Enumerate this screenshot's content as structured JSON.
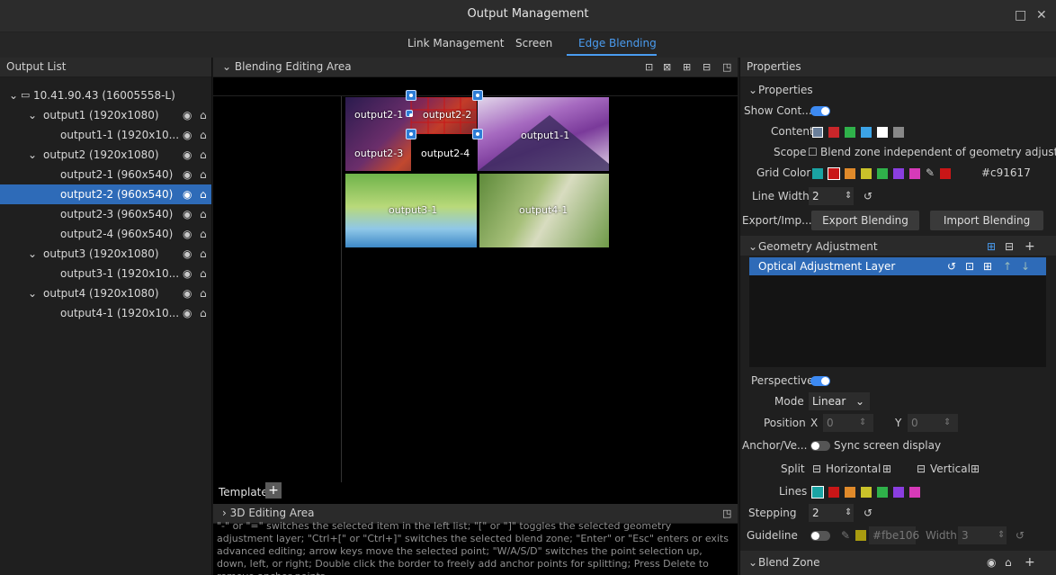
{
  "window": {
    "title": "Output Management",
    "restore_glyph": "□",
    "close_glyph": "✕"
  },
  "tabs": [
    {
      "label": "Link Management"
    },
    {
      "label": "Screen"
    },
    {
      "label": "Edge Blending"
    }
  ],
  "output_list": {
    "header": "Output List",
    "items": [
      {
        "label": "10.41.90.43 (16005558-L)"
      },
      {
        "label": "output1 (1920x1080)"
      },
      {
        "label": "output1-1 (1920x10..."
      },
      {
        "label": "output2 (1920x1080)"
      },
      {
        "label": "output2-1 (960x540)"
      },
      {
        "label": "output2-2 (960x540)"
      },
      {
        "label": "output2-3 (960x540)"
      },
      {
        "label": "output2-4 (960x540)"
      },
      {
        "label": "output3 (1920x1080)"
      },
      {
        "label": "output3-1 (1920x10..."
      },
      {
        "label": "output4 (1920x1080)"
      },
      {
        "label": "output4-1 (1920x10..."
      }
    ]
  },
  "blending_area": {
    "header": "Blending Editing Area",
    "tiles": {
      "t21": "output2-1",
      "t22": "output2-2",
      "t23": "output2-3",
      "t24": "output2-4",
      "t1": "output1-1",
      "t3": "output3-1",
      "t4": "output4-1"
    },
    "template_label": "Template",
    "template_add": "+"
  },
  "editing3d": {
    "header": "3D Editing Area",
    "hint": "\"-\" or \"=\" switches the selected item in the left list; \"[\" or \"]\" toggles the selected geometry adjustment layer; \"Ctrl+[\" or \"Ctrl+]\" switches the selected blend zone; \"Enter\" or \"Esc\" enters or exits advanced editing; arrow keys move the selected point; \"W/A/S/D\" switches the point selection up, down, left, or right; Double click the border to freely add anchor points for splitting; Press Delete to remove anchor points."
  },
  "properties": {
    "header": "Properties",
    "section": "Properties",
    "show_content_label": "Show Cont...",
    "content_label": "Content",
    "scope_label": "Scope",
    "scope_text": "Blend zone independent of geometry adjustment",
    "grid_color_label": "Grid Color",
    "grid_color_value": "#c91617",
    "line_width_label": "Line Width",
    "line_width_value": "2",
    "export_label": "Export/Imp...",
    "export_button": "Export Blending Data",
    "import_button": "Import Blending Data",
    "geometry_section": "Geometry Adjustment",
    "layer_label": "Optical Adjustment Layer",
    "perspective_label": "Perspective",
    "mode_label": "Mode",
    "mode_value": "Linear",
    "position_label": "Position",
    "pos_x_label": "X",
    "pos_x_value": "0",
    "pos_y_label": "Y",
    "pos_y_value": "0",
    "anchor_label": "Anchor/Ve...",
    "sync_label": "Sync screen display",
    "split_label": "Split",
    "split_horizontal": "Horizontal",
    "split_vertical": "Vertical",
    "lines_label": "Lines",
    "stepping_label": "Stepping",
    "stepping_value": "2",
    "guideline_label": "Guideline",
    "guideline_color": "#fbe106",
    "width_label": "Width",
    "width_value": "3",
    "blend_zone_section": "Blend Zone"
  },
  "colors": {
    "accent": "#3d8af2",
    "content_swatches": [
      "#c9262a",
      "#2fb14a",
      "#3ca3e6",
      "#ffffff",
      "#888888"
    ],
    "grid_swatches": [
      "#1aa3a3",
      "#c91617",
      "#e08a2a",
      "#c9c22a",
      "#2fb14a",
      "#8a3ee0",
      "#d63ab8"
    ],
    "line_swatches": [
      "#1aa3a3",
      "#c91617",
      "#e08a2a",
      "#c9c22a",
      "#2fb14a",
      "#8a3ee0",
      "#d63ab8"
    ]
  }
}
